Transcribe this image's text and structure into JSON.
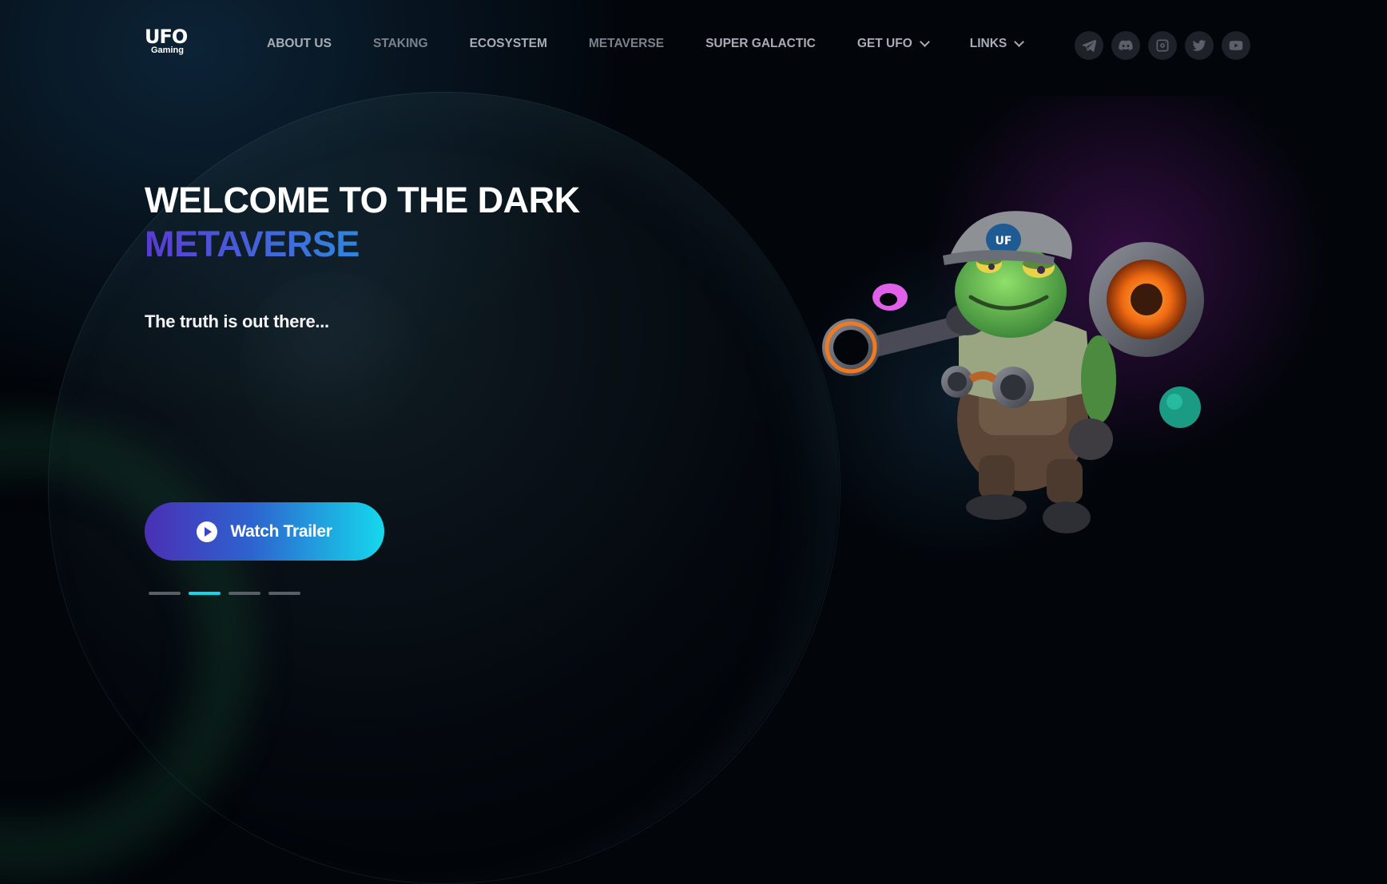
{
  "brand": {
    "logo_main": "UFO",
    "logo_sub": "Gaming"
  },
  "nav": [
    {
      "label": "ABOUT US",
      "dropdown": false,
      "dim": false
    },
    {
      "label": "STAKING",
      "dropdown": false,
      "dim": true
    },
    {
      "label": "ECOSYSTEM",
      "dropdown": false,
      "dim": false
    },
    {
      "label": "METAVERSE",
      "dropdown": false,
      "dim": true
    },
    {
      "label": "SUPER GALACTIC",
      "dropdown": false,
      "dim": false
    },
    {
      "label": "GET UFO",
      "dropdown": true,
      "dim": false
    },
    {
      "label": "LINKS",
      "dropdown": true,
      "dim": false
    }
  ],
  "socials": [
    "telegram-icon",
    "discord-icon",
    "instagram-icon",
    "twitter-icon",
    "youtube-icon"
  ],
  "hero": {
    "title_line1": "WELCOME TO THE DARK",
    "title_line2": "METAVERSE",
    "tagline": "The truth is out there...",
    "cta_label": "Watch Trailer"
  },
  "slider": {
    "count": 4,
    "active_index": 1
  },
  "colors": {
    "background": "#02050a",
    "accent_cyan": "#12d6ee",
    "accent_purple": "#4a2fb5",
    "nav_text": "#a8adb6"
  },
  "illustration": "frog-alien-character"
}
